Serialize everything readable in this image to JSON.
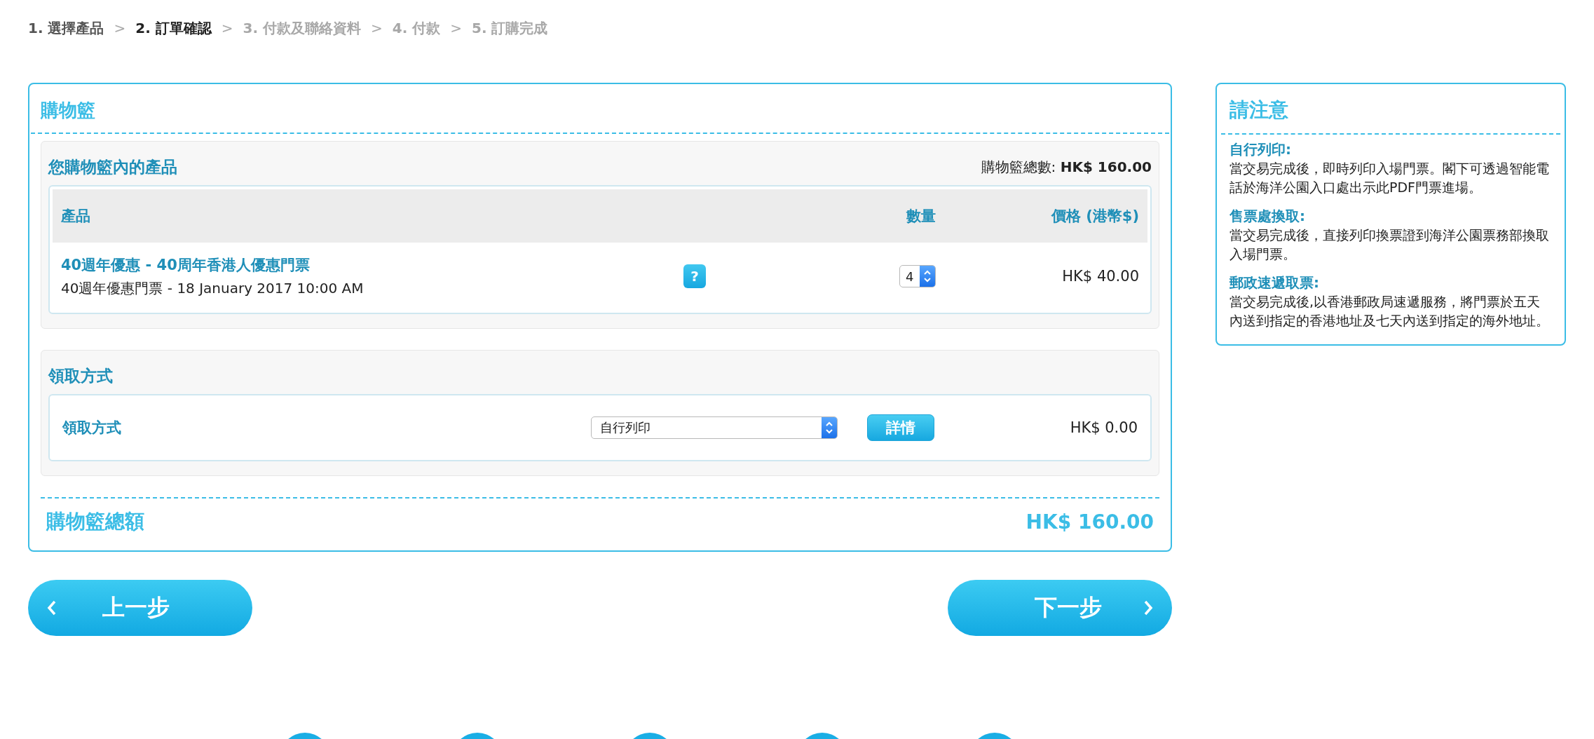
{
  "breadcrumb": {
    "steps": [
      {
        "label": "1. 選擇產品",
        "selected": false,
        "reached": true
      },
      {
        "label": "2. 訂單確認",
        "selected": true,
        "reached": true
      },
      {
        "label": "3. 付款及聯絡資料",
        "selected": false,
        "reached": false
      },
      {
        "label": "4. 付款",
        "selected": false,
        "reached": false
      },
      {
        "label": "5. 訂購完成",
        "selected": false,
        "reached": false
      }
    ],
    "separator": ">"
  },
  "cart": {
    "title": "購物籃",
    "products": {
      "title": "您購物籃內的產品",
      "count_label": "購物籃總數:",
      "count_value": "HK$ 160.00",
      "columns": [
        "產品",
        "數量",
        "價格 (港幣$)"
      ],
      "rows": [
        {
          "name": "40週年優惠 - 40周年香港人優惠門票",
          "detail": "40週年優惠門票 - 18 January 2017 10:00 AM",
          "help": "?",
          "quantity": "4",
          "price": "HK$ 40.00"
        }
      ]
    },
    "pickup": {
      "title": "領取方式",
      "label": "領取方式",
      "value": "自行列印",
      "details_button": "詳情",
      "price": "HK$ 0.00"
    },
    "total_label": "購物籃總額",
    "total_value": "HK$ 160.00"
  },
  "notice": {
    "title": "請注意",
    "items": [
      {
        "heading": "自行列印:",
        "body": "當交易完成後，即時列印入場門票。閣下可透過智能電話於海洋公園入口處出示此PDF門票進場。"
      },
      {
        "heading": "售票處換取:",
        "body": "當交易完成後，直接列印換票證到海洋公園票務部換取入場門票。"
      },
      {
        "heading": "郵政速遞取票:",
        "body": "當交易完成後,以香港郵政局速遞服務，將門票於五天內送到指定的香港地址及七天內送到指定的海外地址。"
      }
    ]
  },
  "nav": {
    "back": "上一步",
    "next": "下一步"
  }
}
